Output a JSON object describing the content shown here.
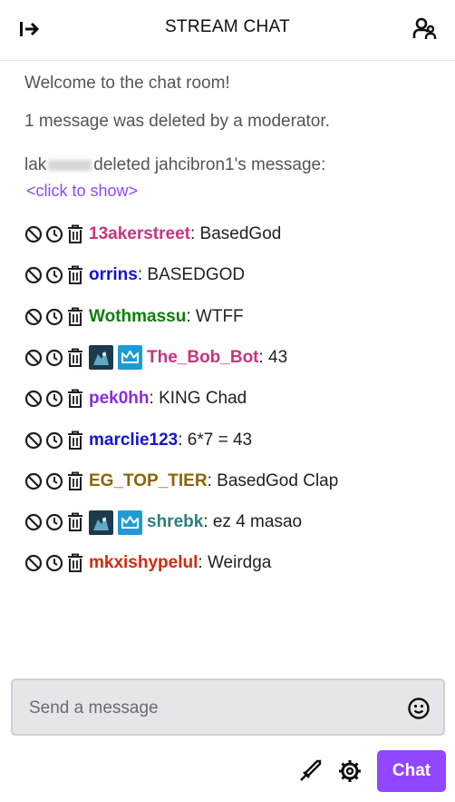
{
  "header": {
    "title": "STREAM CHAT"
  },
  "icons": {
    "collapse": "collapse-arrow-icon",
    "users": "community-icon",
    "ban": "ban-icon",
    "timeout": "timeout-clock-icon",
    "delete": "trash-icon",
    "emote": "smiley-icon",
    "bits": "sword-icon",
    "settings": "gear-icon"
  },
  "system": {
    "welcome": "Welcome to the chat room!",
    "deleted_notice": "1 message was deleted by a moderator.",
    "mod_prefix": "lak",
    "mod_suffix": "deleted jahcibron1's message:",
    "show_link": "<click to show>"
  },
  "messages": [
    {
      "user": "13akerstreet",
      "color": "#c8347f",
      "text": ": BasedGod",
      "badges": []
    },
    {
      "user": "orrins",
      "color": "#1414d6",
      "text": ": BASEDGOD",
      "badges": []
    },
    {
      "user": "Wothmassu",
      "color": "#0a7f0a",
      "text": ": WTFF",
      "badges": []
    },
    {
      "user": "The_Bob_Bot",
      "color": "#c8347f",
      "text": ": 43",
      "badges": [
        "bot",
        "crown"
      ]
    },
    {
      "user": "pek0hh",
      "color": "#8a2be2",
      "text": ": KING Chad",
      "badges": []
    },
    {
      "user": "marclie123",
      "color": "#1414d6",
      "text": ": 6*7 = 43",
      "badges": []
    },
    {
      "user": "EG_TOP_TIER",
      "color": "#8b6508",
      "text": ": BasedGod Clap",
      "badges": []
    },
    {
      "user": "shrebk",
      "color": "#2e7d7d",
      "text": ": ez 4 masao",
      "badges": [
        "bot",
        "crown"
      ]
    },
    {
      "user": "mkxishypelul",
      "color": "#d42a0a",
      "text": ": Weirdga",
      "badges": []
    }
  ],
  "input": {
    "placeholder": "Send a message",
    "value": ""
  },
  "chat_button": "Chat",
  "colors": {
    "accent": "#9147ff"
  }
}
